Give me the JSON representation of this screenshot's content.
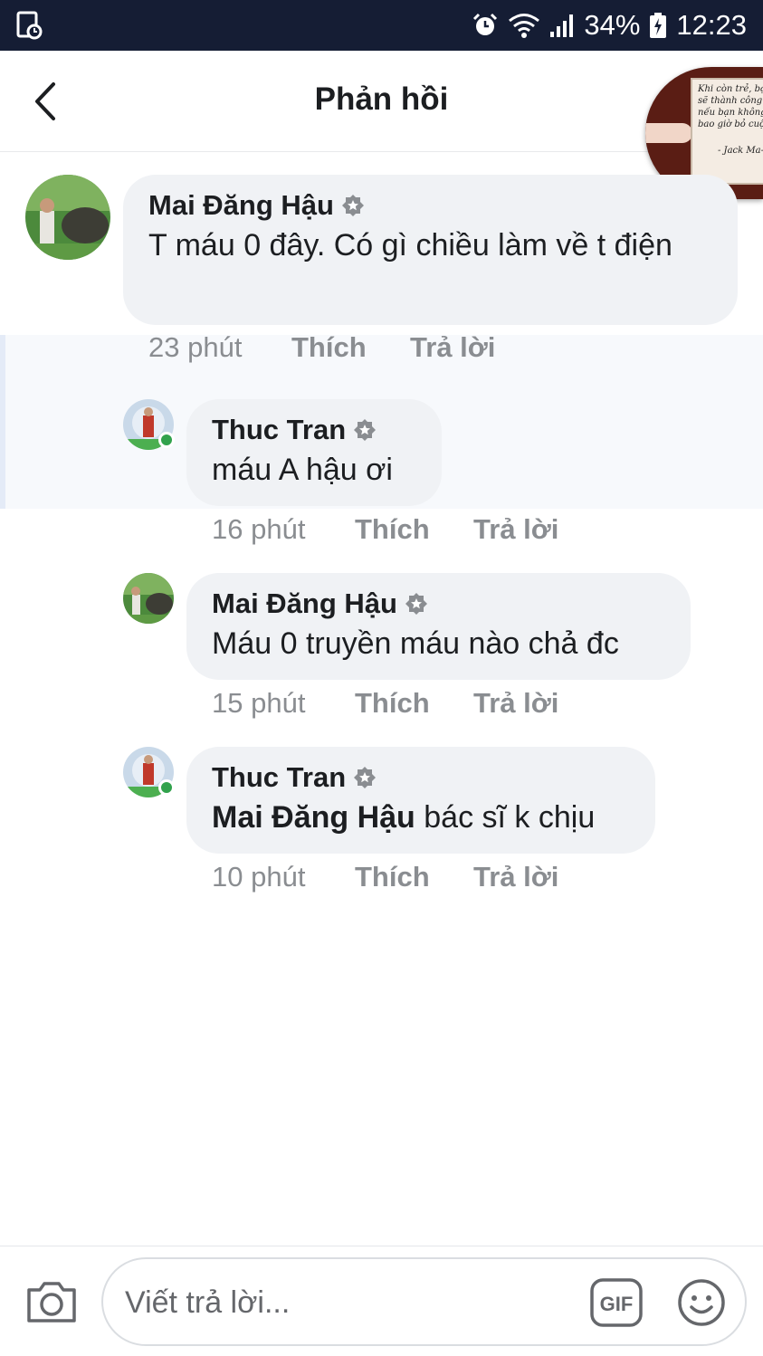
{
  "status_bar": {
    "battery": "34%",
    "time": "12:23"
  },
  "header": {
    "title": "Phản hồi"
  },
  "chat_head": {
    "quote": "Khi còn trẻ, bạn\nsẽ thành công\nnếu bạn không\nbao giờ bỏ cuộc",
    "author": "- Jack Ma-"
  },
  "comments": [
    {
      "name": "Mai Đăng Hậu",
      "text": "T máu 0 đây. Có gì chiều làm về t điện",
      "time": "23 phút",
      "like": "Thích",
      "reply": "Trả lời"
    },
    {
      "name": "Thuc Tran",
      "text": "máu A hậu ơi",
      "time": "16 phút",
      "like": "Thích",
      "reply": "Trả lời"
    },
    {
      "name": "Mai Đăng Hậu",
      "text": "Máu 0 truyền máu nào chả đc",
      "time": "15 phút",
      "like": "Thích",
      "reply": "Trả lời"
    },
    {
      "name": "Thuc Tran",
      "mention": "Mai Đăng Hậu",
      "text": " bác sĩ k chịu",
      "time": "10 phút",
      "like": "Thích",
      "reply": "Trả lời"
    }
  ],
  "composer": {
    "placeholder": "Viết trả lời...",
    "gif_label": "GIF"
  },
  "colors": {
    "status_bar_bg": "#151d34",
    "bubble_bg": "#f0f2f5",
    "meta_text": "#8a8d91",
    "online_green": "#31a24c"
  }
}
